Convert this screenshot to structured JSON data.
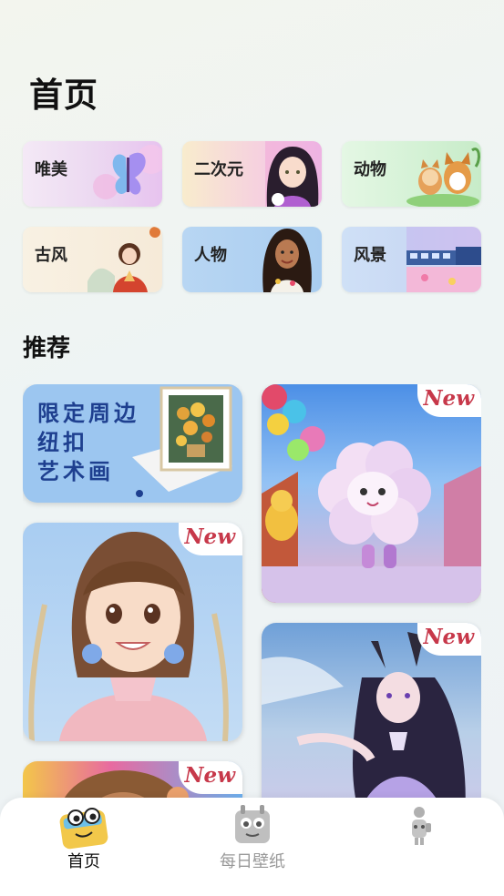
{
  "page": {
    "title": "首页"
  },
  "categories": [
    {
      "label": "唯美"
    },
    {
      "label": "二次元"
    },
    {
      "label": "动物"
    },
    {
      "label": "古风"
    },
    {
      "label": "人物"
    },
    {
      "label": "风景"
    }
  ],
  "recommend": {
    "title": "推荐",
    "promo": {
      "line1": "限定周边",
      "line2": "纽扣",
      "line3": "艺术画"
    },
    "badge": "New"
  },
  "tabbar": {
    "items": [
      {
        "label": "首页",
        "active": true,
        "icon": "home-monster-icon"
      },
      {
        "label": "每日壁纸",
        "active": false,
        "icon": "calendar-monster-icon"
      },
      {
        "label": "",
        "active": false,
        "icon": "profile-figure-icon"
      }
    ]
  },
  "colors": {
    "badge": "#c7384a",
    "promo_text": "#1e3f8f",
    "active_tab": "#111111",
    "inactive_tab": "#999999"
  }
}
